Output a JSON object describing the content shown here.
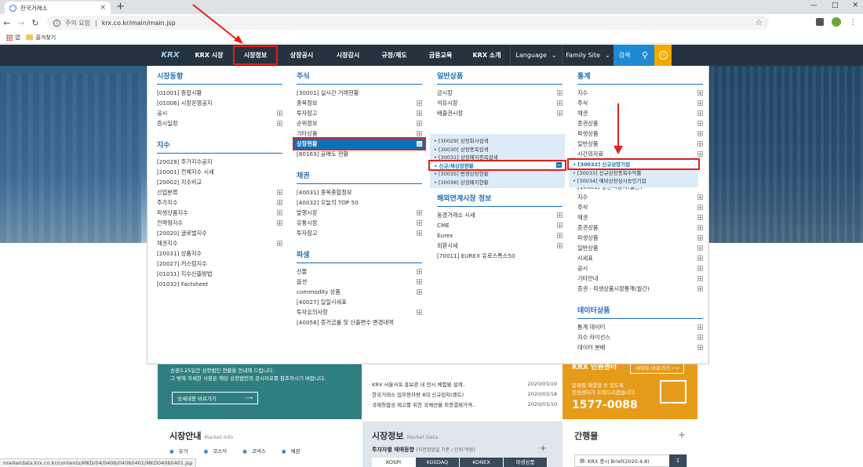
{
  "browser": {
    "tab_title": "한국거래소",
    "tab_close": "×",
    "new_tab": "+",
    "insecure": "주의 요함",
    "url": "krx.co.kr/main/main.jsp",
    "bookmarks": [
      {
        "label": "앱"
      },
      {
        "label": "즐겨찾기"
      }
    ],
    "status_url": "marketdata.krx.co.kr/contents/MKD/04/0406/04060401/MKD04060401.jsp"
  },
  "gnb": {
    "logo": "KRX",
    "items": [
      "KRX 시장",
      "시장정보",
      "상장공시",
      "시장감시",
      "규정/제도",
      "금융교육",
      "KRX 소개"
    ],
    "language": "Language",
    "family_site": "Family Site",
    "search": "검색"
  },
  "mega": {
    "col1": {
      "groups": [
        {
          "title": "시장동향",
          "items": [
            {
              "label": "[01001] 종합시황",
              "plus": false
            },
            {
              "label": "[01006] 시장운영공지",
              "plus": false
            },
            {
              "label": "공시",
              "plus": true
            },
            {
              "label": "증시일정",
              "plus": true
            }
          ]
        },
        {
          "title": "지수",
          "items": [
            {
              "label": "[20028] 주가지수공지",
              "plus": false
            },
            {
              "label": "[20001] 전체지수 시세",
              "plus": false
            },
            {
              "label": "[20002] 지수비교",
              "plus": false
            },
            {
              "label": "산업분류",
              "plus": true
            },
            {
              "label": "주가지수",
              "plus": true
            },
            {
              "label": "파생상품지수",
              "plus": true
            },
            {
              "label": "전략형지수",
              "plus": true
            },
            {
              "label": "[20020] 글로벌지수",
              "plus": false
            },
            {
              "label": "채권지수",
              "plus": true
            },
            {
              "label": "[20031] 상품지수",
              "plus": false
            },
            {
              "label": "[20027] 커스텀지수",
              "plus": false
            },
            {
              "label": "[01031] 지수산출방법",
              "plus": false
            },
            {
              "label": "[01032] Factsheet",
              "plus": false
            }
          ]
        }
      ]
    },
    "col2": {
      "groups": [
        {
          "title": "주식",
          "items": [
            {
              "label": "[30001] 실시간 거래현황",
              "plus": false
            },
            {
              "label": "종목정보",
              "plus": true
            },
            {
              "label": "투자참고",
              "plus": true
            },
            {
              "label": "순위정보",
              "plus": true
            },
            {
              "label": "기타상품",
              "plus": true
            },
            {
              "label": "상장현황",
              "plus": true,
              "hl": true
            },
            {
              "label": "[80163] 공매도 현황",
              "plus": false
            }
          ]
        },
        {
          "title": "채권",
          "items": [
            {
              "label": "[40031] 종목종합정보",
              "plus": false
            },
            {
              "label": "[40032] 오늘의 TOP 50",
              "plus": false
            },
            {
              "label": "발행시장",
              "plus": true
            },
            {
              "label": "유통시장",
              "plus": true
            },
            {
              "label": "투자참고",
              "plus": true
            }
          ]
        },
        {
          "title": "파생",
          "items": [
            {
              "label": "선물",
              "plus": true
            },
            {
              "label": "옵션",
              "plus": true
            },
            {
              "label": "commodity 상품",
              "plus": true
            },
            {
              "label": "[40027] 일일시세표",
              "plus": false
            },
            {
              "label": "투자유의사항",
              "plus": true
            },
            {
              "label": "[40058] 증거금률 및 산출변수 변경내역",
              "plus": false
            }
          ]
        }
      ]
    },
    "col3": {
      "groups": [
        {
          "title": "일반상품",
          "items": [
            {
              "label": "금시장",
              "plus": true
            },
            {
              "label": "석유시장",
              "plus": true
            },
            {
              "label": "배출권시장",
              "plus": true
            }
          ]
        },
        {
          "title": "해외연계시장 정보",
          "items": [
            {
              "label": "동경거래소 시세",
              "plus": true
            },
            {
              "label": "CME",
              "plus": true
            },
            {
              "label": "Eurex",
              "plus": true
            },
            {
              "label": "외환시세",
              "plus": true
            },
            {
              "label": "[70011] EUREX 유로스톡스50",
              "plus": false
            }
          ]
        }
      ],
      "submenu": [
        {
          "label": "• [30029] 상장회사검색",
          "hl": false
        },
        {
          "label": "• [30030] 상장종목검색",
          "hl": false
        },
        {
          "label": "• [30031] 상장폐지종목검색",
          "hl": false
        },
        {
          "label": "• 신규/재상장현황",
          "hl": true
        },
        {
          "label": "• [30035] 변경상장현황",
          "hl": false
        },
        {
          "label": "• [30036] 상장폐지현황",
          "hl": false
        }
      ]
    },
    "col4": {
      "groups": [
        {
          "title": "통계",
          "items": [
            {
              "label": "지수",
              "plus": true
            },
            {
              "label": "주식",
              "plus": true
            },
            {
              "label": "채권",
              "plus": true
            },
            {
              "label": "증권상품",
              "plus": true
            },
            {
              "label": "파생상품",
              "plus": true
            },
            {
              "label": "일반상품",
              "plus": true
            },
            {
              "label": "시간외자료",
              "plus": true
            }
          ]
        },
        {
          "title": "",
          "items": [
            {
              "label": "[10001] 증권시장지(일간)",
              "plus": false
            },
            {
              "label": "지수",
              "plus": true
            },
            {
              "label": "주식",
              "plus": true
            },
            {
              "label": "채권",
              "plus": true
            },
            {
              "label": "증권상품",
              "plus": true
            },
            {
              "label": "파생상품",
              "plus": true
            },
            {
              "label": "일반상품",
              "plus": true
            },
            {
              "label": "시세표",
              "plus": true
            },
            {
              "label": "공시",
              "plus": true
            },
            {
              "label": "기타안내",
              "plus": true
            },
            {
              "label": "증권 · 파생상품시장통계(월간)",
              "plus": true
            }
          ]
        },
        {
          "title": "데이터상품",
          "items": [
            {
              "label": "통계 데이터",
              "plus": true
            },
            {
              "label": "지수 라이선스",
              "plus": true
            },
            {
              "label": "데이터 분배",
              "plus": true
            }
          ]
        }
      ],
      "submenu": [
        {
          "label": "• [30032] 신규상장기업",
          "hl": true
        },
        {
          "label": "• [30033] 신규상장종목수익률",
          "hl": false
        },
        {
          "label": "• [30034] 예비상장심사승인기업",
          "hl": false
        }
      ]
    }
  },
  "page": {
    "teal_text_1": "승권3.25일간 상장법인 현황을 안내해 드립니다.",
    "teal_text_2": "그 밖에 자세한 사항은 해당 상장법인의 공시자료를 참조하시기 바랍니다.",
    "teal_btn": "상세내용 바로가기",
    "news": [
      {
        "title": "· KRX 서울사옥 홍보관 내 전시 체험물 설계..",
        "date": "2020/03/19"
      },
      {
        "title": "· 한국거래소 업무용차량 8대 신규임차(렌트)",
        "date": "2020/03/18"
      },
      {
        "title": "· 국제청합성 제고를 위한 국채선물 최종결제가격..",
        "date": "2020/03/10"
      }
    ],
    "center_title": "KRX 민원센터",
    "center_btn": "사이트 바로가기",
    "center_desc_1": "문제를 해결할 수 있도록",
    "center_desc_2": "민원센터가 도와드리겠습니다.",
    "center_phone": "1577-0088",
    "market_guide": "시장안내",
    "market_guide_sub": "Market Info",
    "market_icons": [
      "유가",
      "코스닥",
      "코넥스",
      "채권"
    ],
    "market_data": "시장정보",
    "market_data_sub": "Market Data",
    "invest_trend": "투자자별 매매동향",
    "invest_trend_sub": "(직전영업일 기준 / 단위:억원)",
    "market_tabs": [
      "KOSPI",
      "KOSDAQ",
      "KONEX",
      "파생상품"
    ],
    "publications": "간행물",
    "pub_item": "KRX 증시 Brief(2020.4.8)"
  },
  "colors": {
    "gnb": "#26323e",
    "accent": "#1b6cb4",
    "highlight": "#e3201b",
    "orange": "#e79b1a"
  }
}
